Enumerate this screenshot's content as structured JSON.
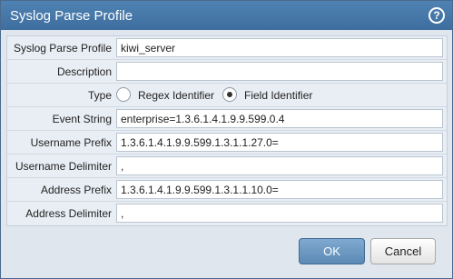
{
  "dialog": {
    "title": "Syslog Parse Profile",
    "help_icon": "?",
    "icon_name": "help-circle-icon"
  },
  "form": {
    "name": {
      "label": "Syslog Parse Profile",
      "value": "kiwi_server"
    },
    "description": {
      "label": "Description",
      "value": ""
    },
    "type": {
      "label": "Type",
      "options": [
        {
          "label": "Regex Identifier",
          "checked": false
        },
        {
          "label": "Field Identifier",
          "checked": true
        }
      ]
    },
    "event_string": {
      "label": "Event String",
      "value": "enterprise=1.3.6.1.4.1.9.9.599.0.4"
    },
    "username_prefix": {
      "label": "Username Prefix",
      "value": "1.3.6.1.4.1.9.9.599.1.3.1.1.27.0="
    },
    "username_delimiter": {
      "label": "Username Delimiter",
      "value": ","
    },
    "address_prefix": {
      "label": "Address Prefix",
      "value": "1.3.6.1.4.1.9.9.599.1.3.1.1.10.0="
    },
    "address_delimiter": {
      "label": "Address Delimiter",
      "value": ","
    }
  },
  "buttons": {
    "ok_label": "OK",
    "cancel_label": "Cancel"
  },
  "colors": {
    "titlebar": "#4a7aab",
    "ok_button": "#6b98c2"
  }
}
